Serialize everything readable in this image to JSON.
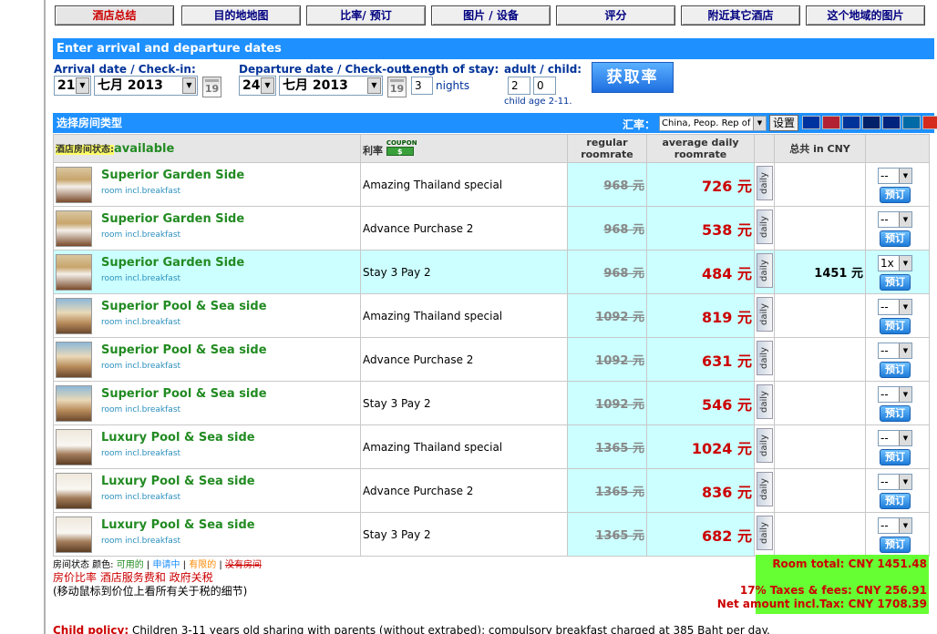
{
  "tabs": [
    "酒店总结",
    "目的地地图",
    "比率/ 预订",
    "图片 / 设备",
    "评分",
    "附近其它酒店",
    "这个地域的图片"
  ],
  "dates": {
    "header": "Enter arrival and departure dates",
    "arrival_label": "Arrival date / Check-in:",
    "arrival_day": "21",
    "arrival_month": "七月  2013",
    "departure_label": "Departure date / Check-out:",
    "departure_day": "24",
    "departure_month": "七月  2013",
    "calendar_day": "19",
    "stay_label": "Length of stay:",
    "stay_value": "3",
    "nights": "nights",
    "guests_label": "adult / child:",
    "adults": "2",
    "children": "0",
    "child_age": "child age 2-11.",
    "get_rate_button": "获取率"
  },
  "room_header": {
    "title": "选择房间类型",
    "currency_label": "汇率：",
    "currency_value": "China, Peop. Rep of",
    "set_button": "设置",
    "flags": [
      "#0033a0",
      "#b22234",
      "#003399",
      "#012169",
      "#00247d",
      "#006aa7",
      "#d52b1e",
      "#bc002d",
      "#de2910"
    ]
  },
  "table": {
    "status_label": "酒店房间状态:",
    "status_value": "available",
    "rate_col": "利率",
    "coupon": "COUPON",
    "coupon_icon": "$",
    "regular_col": "regular roomrate",
    "avg_col": "average daily roomrate",
    "total_col": "总共 in CNY",
    "daily_label": "daily",
    "book_label": "预订",
    "rows": [
      {
        "name": "Superior Garden Side",
        "sub": "room incl.breakfast",
        "rate": "Amazing Thailand special",
        "regular": "968 元",
        "avg": "726 元",
        "total": "",
        "qty": "--"
      },
      {
        "name": "Superior Garden Side",
        "sub": "room incl.breakfast",
        "rate": "Advance Purchase 2",
        "regular": "968 元",
        "avg": "538 元",
        "total": "",
        "qty": "--"
      },
      {
        "name": "Superior Garden Side",
        "sub": "room incl.breakfast",
        "rate": "Stay 3 Pay 2",
        "regular": "968 元",
        "avg": "484 元",
        "total": "1451 元",
        "qty": "1x"
      },
      {
        "name": "Superior Pool & Sea side",
        "sub": "room incl.breakfast",
        "rate": "Amazing Thailand special",
        "regular": "1092 元",
        "avg": "819 元",
        "total": "",
        "qty": "--"
      },
      {
        "name": "Superior Pool & Sea side",
        "sub": "room incl.breakfast",
        "rate": "Advance Purchase 2",
        "regular": "1092 元",
        "avg": "631 元",
        "total": "",
        "qty": "--"
      },
      {
        "name": "Superior Pool & Sea side",
        "sub": "room incl.breakfast",
        "rate": "Stay 3 Pay 2",
        "regular": "1092 元",
        "avg": "546 元",
        "total": "",
        "qty": "--"
      },
      {
        "name": "Luxury Pool & Sea side",
        "sub": "room incl.breakfast",
        "rate": "Amazing Thailand special",
        "regular": "1365 元",
        "avg": "1024 元",
        "total": "",
        "qty": "--"
      },
      {
        "name": "Luxury Pool & Sea side",
        "sub": "room incl.breakfast",
        "rate": "Advance Purchase 2",
        "regular": "1365 元",
        "avg": "836 元",
        "total": "",
        "qty": "--"
      },
      {
        "name": "Luxury Pool & Sea side",
        "sub": "room incl.breakfast",
        "rate": "Stay 3 Pay 2",
        "regular": "1365 元",
        "avg": "682 元",
        "total": "",
        "qty": "--"
      }
    ]
  },
  "footer": {
    "legend_prefix": "房间状态 颜色:",
    "legend_available": "可用的",
    "legend_request": "申请中",
    "legend_limited": "有限的",
    "legend_none": "没有房间",
    "line2": "房价比率 酒店服务费和 政府关税",
    "line3": "(移动鼠标到价位上看所有关于税的细节)",
    "room_total": "Room total: CNY 1451.48",
    "taxes": "17% Taxes & fees: CNY 256.91",
    "net": "Net amount incl.Tax: CNY 1708.39",
    "child_policy_label": "Child policy:",
    "child_policy": "Children 3-11 years old sharing with parents (without extrabed): compulsory breakfast charged at 385 Baht per day."
  }
}
